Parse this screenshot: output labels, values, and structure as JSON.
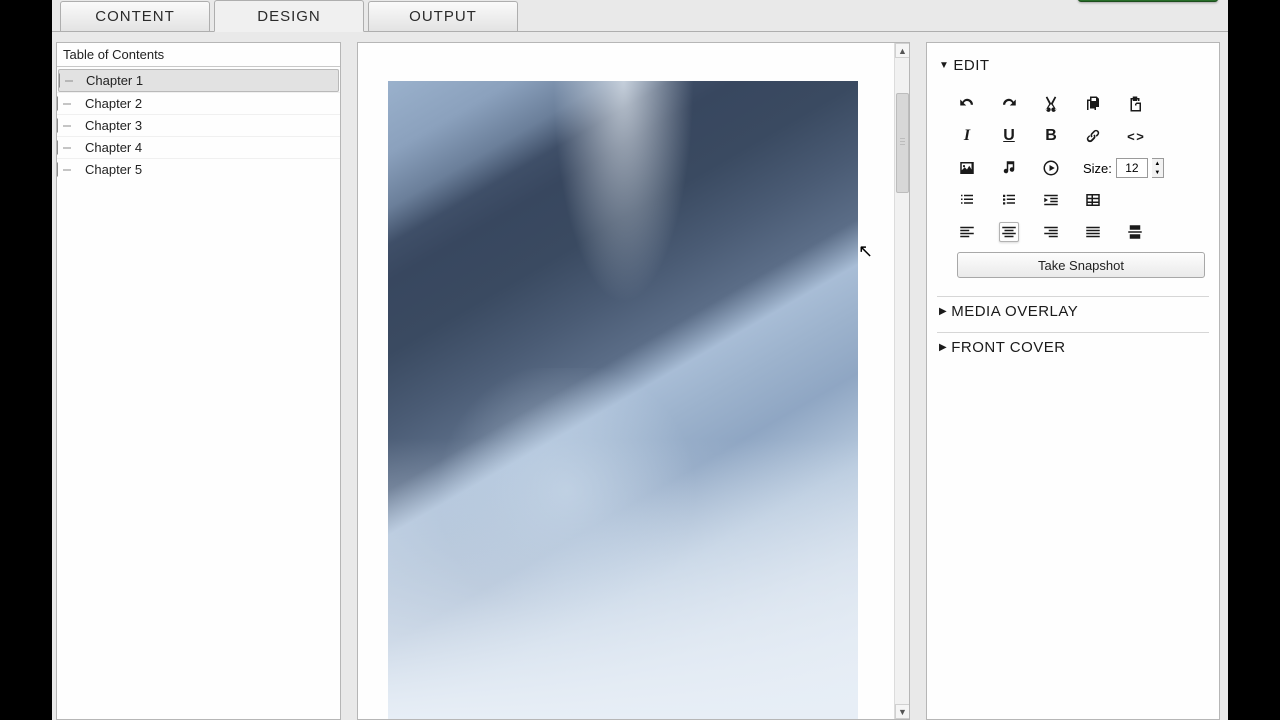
{
  "tabs": {
    "content": "CONTENT",
    "design": "DESIGN",
    "output": "OUTPUT",
    "active": "design"
  },
  "toc": {
    "heading": "Table of Contents",
    "items": [
      "Chapter 1",
      "Chapter 2",
      "Chapter 3",
      "Chapter 4",
      "Chapter 5"
    ],
    "selected_index": 0
  },
  "side": {
    "edit": {
      "title": "EDIT",
      "expanded": true,
      "size_label": "Size:",
      "size_value": "12",
      "snapshot": "Take Snapshot",
      "italic": "I",
      "underline": "U",
      "bold": "B",
      "code": "< >"
    },
    "media_overlay": {
      "title": "MEDIA OVERLAY",
      "expanded": false
    },
    "front_cover": {
      "title": "FRONT COVER",
      "expanded": false
    }
  },
  "colors": {
    "bg": "#e9e9e9",
    "panel": "#fefefe",
    "border": "#b6b6b6",
    "build": "#286e29"
  }
}
